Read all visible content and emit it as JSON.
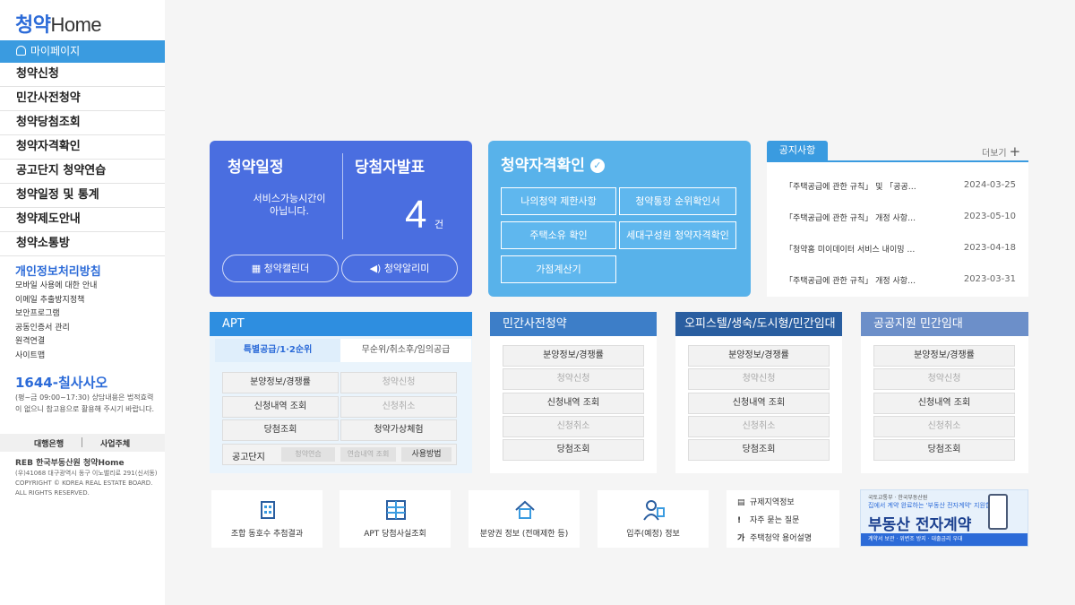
{
  "sidebar": {
    "logo_a": "청약",
    "logo_b": "Home",
    "mypage": "마이페이지",
    "menu": [
      "청약신청",
      "민간사전청약",
      "청약당첨조회",
      "청약자격확인",
      "공고단지 청약연습",
      "청약일정 및 통계",
      "청약제도안내",
      "청약소통방"
    ],
    "privacy": "개인정보처리방침",
    "links": [
      "모바일 사용에 대한 안내",
      "이메일 추출방지정책",
      "보안프로그램",
      "공동인증서 관리",
      "원격연결",
      "사이트맵"
    ],
    "phone": "1644-칠사사오",
    "hours": "(평~금 09:00~17:30) 상담내용은 법적효력이 없으니 참고용으로 활용해 주시기 바랍니다.",
    "bank": "대행은행",
    "operator": "사업주체",
    "footer_org": "REB 한국부동산원 청약Home",
    "footer_addr": "(우)41068 대구광역시 동구 이노밸리로 291(신서동)",
    "footer_copy": "COPYRIGHT © KOREA REAL ESTATE BOARD.",
    "footer_rights": "ALL RIGHTS RESERVED."
  },
  "schedule_card": {
    "title": "청약일정",
    "message": "서비스가능시간이 아닙니다.",
    "winners_title": "당첨자발표",
    "winners_count": "4",
    "winners_unit": "건",
    "calendar_btn": "청약캘린더",
    "alarm_btn": "청약알리미"
  },
  "qualify_card": {
    "title": "청약자격확인",
    "buttons": [
      "나의청약 제한사항",
      "청약통장 순위확인서",
      "주택소유 확인",
      "세대구성원 청약자격확인",
      "가점계산기"
    ]
  },
  "notice": {
    "tab": "공지사항",
    "more": "더보기",
    "items": [
      {
        "title": "「주택공급에 관한 규칙」 및 「공공…",
        "date": "2024-03-25"
      },
      {
        "title": "「주택공급에 관한 규칙」 개정 사항…",
        "date": "2023-05-10"
      },
      {
        "title": "「청약홈 미이데이터 서비스 내이밍 …",
        "date": "2023-04-18"
      },
      {
        "title": "「주택공급에 관한 규칙」 개정 사항…",
        "date": "2023-03-31"
      }
    ]
  },
  "apt": {
    "title": "APT",
    "tab1": "특별공급/1·2순위",
    "tab2": "무순위/취소후/임의공급",
    "buttons": [
      "분양정보/경쟁률",
      "청약신청",
      "신청내역 조회",
      "신청취소",
      "당첨조회",
      "청약가상체험"
    ],
    "complex_label": "공고단지",
    "complex_btns": [
      "청약연습",
      "연습내역 조회",
      "사용방법"
    ]
  },
  "panels": [
    {
      "title": "민간사전청약",
      "buttons": [
        "분양정보/경쟁률",
        "청약신청",
        "신청내역 조회",
        "신청취소",
        "당첨조회"
      ]
    },
    {
      "title": "오피스텔/생숙/도시형/민간임대",
      "buttons": [
        "분양정보/경쟁률",
        "청약신청",
        "신청내역 조회",
        "신청취소",
        "당첨조회"
      ]
    },
    {
      "title": "공공지원 민간임대",
      "buttons": [
        "분양정보/경쟁률",
        "청약신청",
        "신청내역 조회",
        "신청취소",
        "당첨조회"
      ]
    }
  ],
  "quick": [
    "조합 동호수 추첨결과",
    "APT 당첨사실조회",
    "분양권 정보 (전매제한 등)",
    "입주(예정) 정보"
  ],
  "faq": [
    "규제지역정보",
    "자주 묻는 질문",
    "주택청약 용어설명"
  ],
  "banner": {
    "top": "국토교통부 · 한국부동산원",
    "sub": "집에서 계약 완료하는 '부동산 전자계약' 지원합니다",
    "main_a": "부동산 ",
    "main_b": "전자계약",
    "foot": "계약서 보관 · 위변조 방지 · 대출금리 우대"
  },
  "colors": {
    "blue_card": "#4a6ee0",
    "sky_card": "#58b2ea",
    "accent": "#3a9be0",
    "apt_head": "#2e8ee0",
    "dark_head": "#2a5ea0"
  }
}
